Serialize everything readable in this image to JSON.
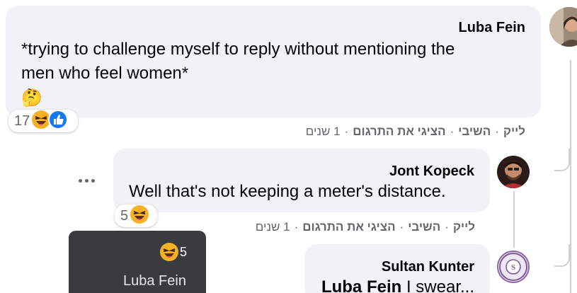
{
  "comments": [
    {
      "author": "Luba Fein",
      "lines": [
        "*trying to challenge myself to reply without mentioning the",
        "men who feel women*"
      ],
      "emoji": "🤔",
      "reaction_count": "17",
      "reaction_icons": [
        "laughing-emoji-icon",
        "like-icon"
      ],
      "actions": {
        "like": "לייק",
        "reply": "השיבי",
        "translate": "הציגי את התרגום",
        "time": "1 שנים"
      }
    },
    {
      "author": "Jont Kopeck",
      "text": "Well that's not keeping a meter's distance.",
      "reaction_count": "5",
      "reaction_icons": [
        "laughing-emoji-icon"
      ],
      "actions": {
        "like": "לייק",
        "reply": "השיבי",
        "translate": "הציגי את התרגום",
        "time": "1 שנים"
      }
    },
    {
      "author": "Sultan Kunter",
      "mention": "Luba Fein",
      "text_rest": " I swear..."
    }
  ],
  "reaction_tooltip": {
    "count": "5",
    "name": "Luba Fein"
  },
  "colors": {
    "bubble": "#f0f2f5",
    "meta_text": "#65676b",
    "like_blue": "#1877f2",
    "emoji_yellow": "#f7b125",
    "tooltip_bg": "#3a3b3c"
  }
}
